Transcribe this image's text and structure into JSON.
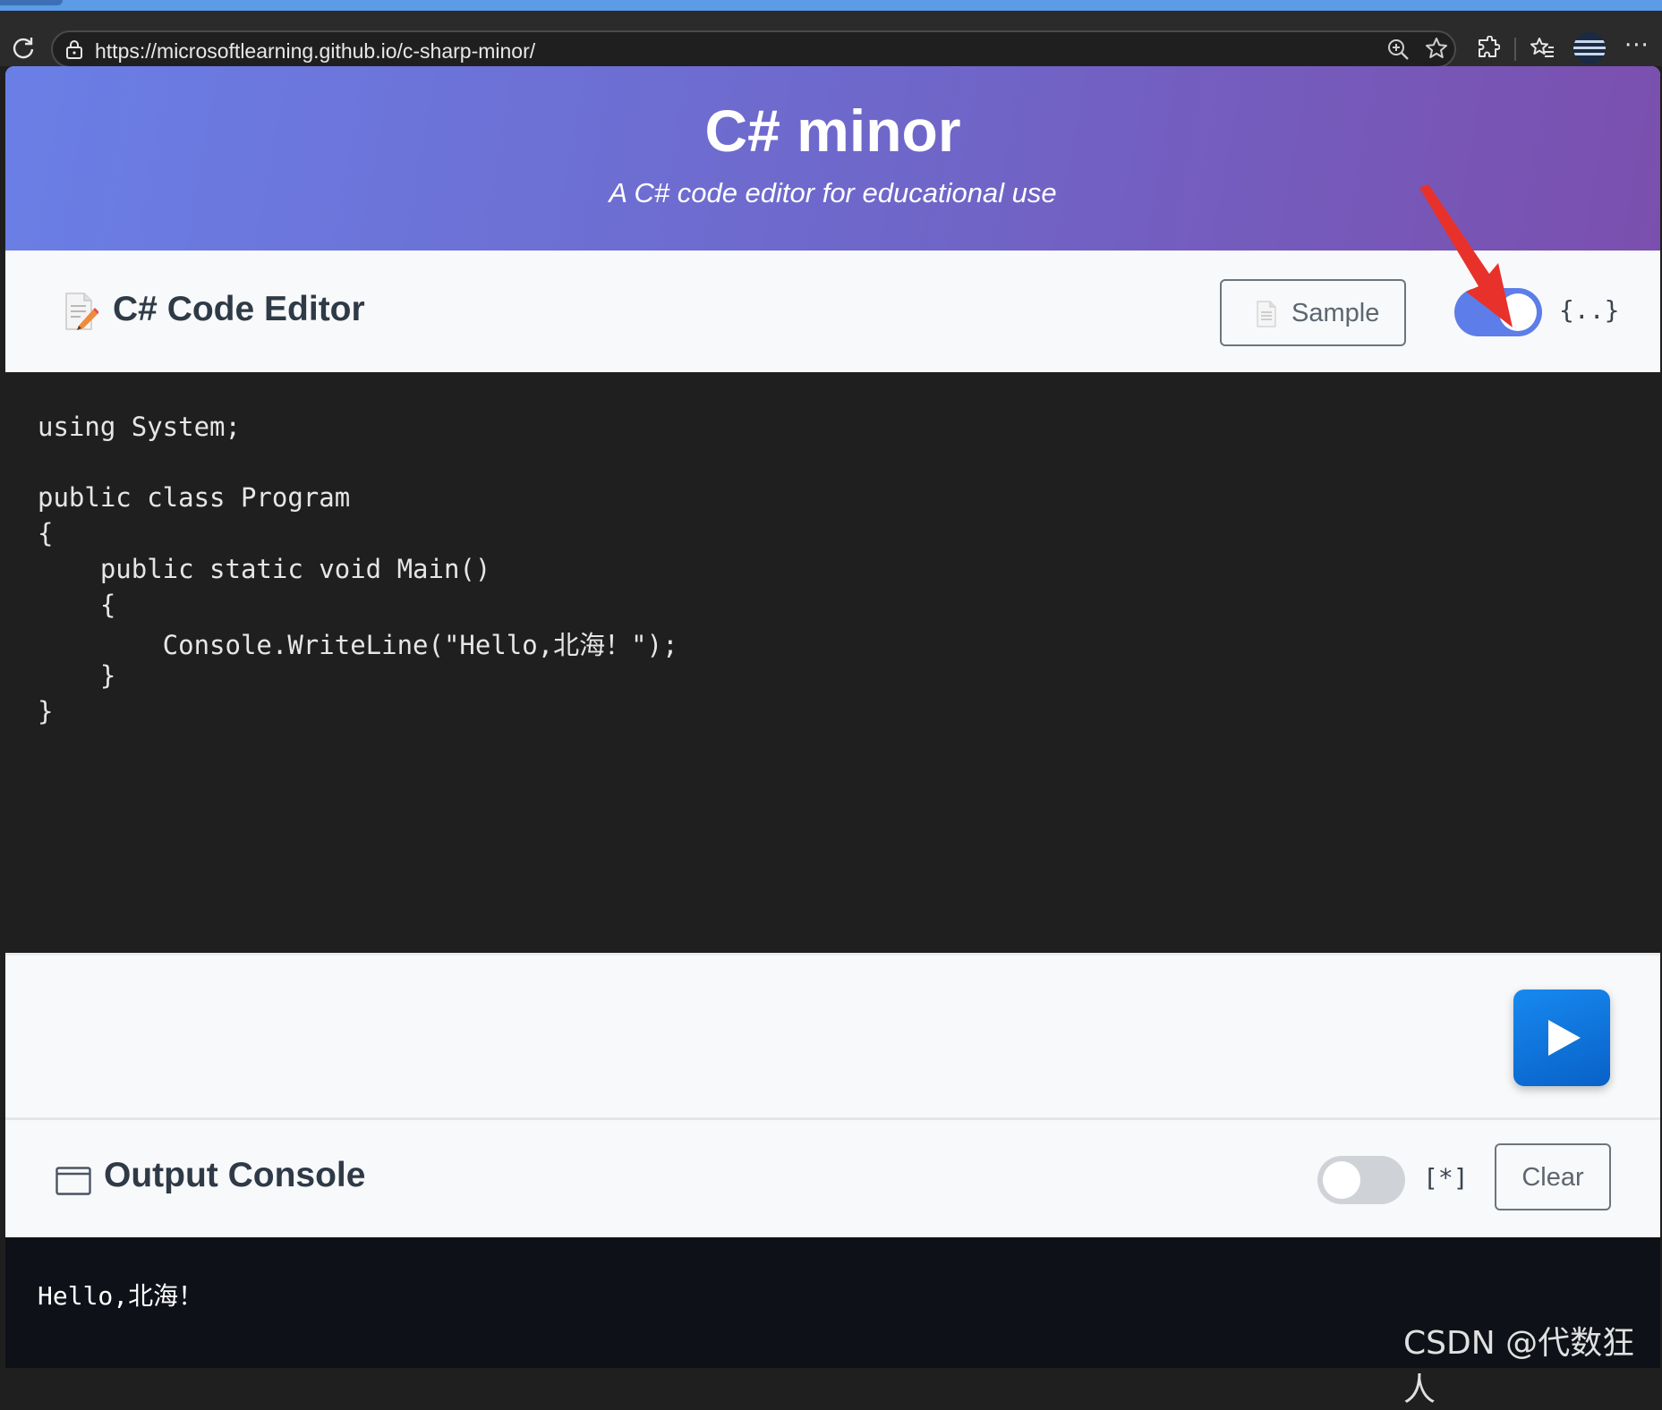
{
  "browser": {
    "url": "https://microsoftlearning.github.io/c-sharp-minor/",
    "more_label": "···"
  },
  "hero": {
    "title": "C# minor",
    "subtitle": "A C# code editor for educational use"
  },
  "editor": {
    "title": "C# Code Editor",
    "sample_label": "Sample",
    "format_toggle_on": true,
    "format_label": "{..}",
    "code_lines": [
      "using System;",
      "",
      "public class Program",
      "{",
      "    public static void Main()",
      "    {",
      "        Console.WriteLine(\"Hello,北海！\");",
      "    }",
      "}"
    ]
  },
  "run": {
    "icon": "play-icon"
  },
  "output": {
    "title": "Output Console",
    "wrap_toggle_on": false,
    "wrap_label": "[*]",
    "clear_label": "Clear",
    "lines": [
      "Hello,北海！"
    ]
  },
  "watermark": "CSDN @代数狂人",
  "colors": {
    "hero_start": "#6a7fe6",
    "hero_end": "#7b4fae",
    "toggle_on": "#5d7de8",
    "run_button": "#0d6efd",
    "annotation_arrow": "#e8312b"
  }
}
